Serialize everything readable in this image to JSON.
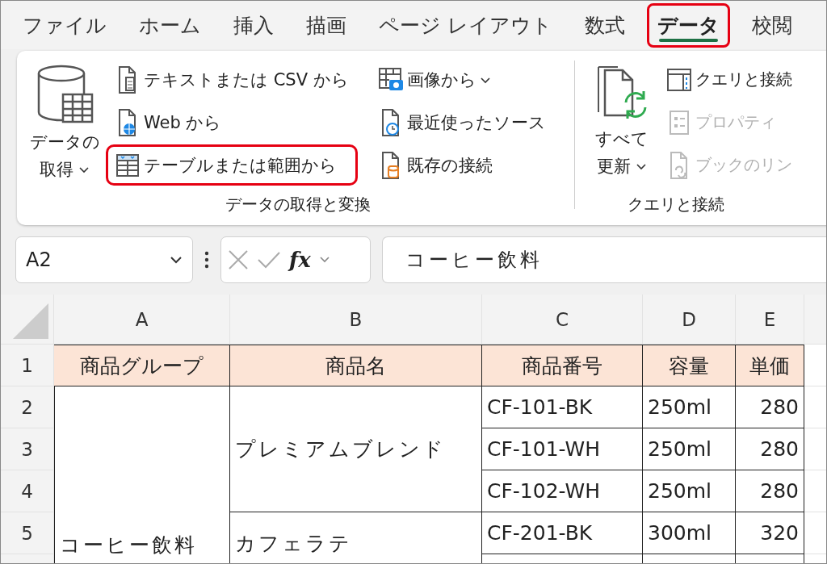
{
  "menu_tabs": [
    {
      "label": "ファイル",
      "selected": false,
      "highlighted": false
    },
    {
      "label": "ホーム",
      "selected": false,
      "highlighted": false
    },
    {
      "label": "挿入",
      "selected": false,
      "highlighted": false
    },
    {
      "label": "描画",
      "selected": false,
      "highlighted": false
    },
    {
      "label": "ページ レイアウト",
      "selected": false,
      "highlighted": false
    },
    {
      "label": "数式",
      "selected": false,
      "highlighted": false
    },
    {
      "label": "データ",
      "selected": true,
      "highlighted": true
    },
    {
      "label": "校閲",
      "selected": false,
      "highlighted": false
    }
  ],
  "ribbon": {
    "groups": [
      {
        "label": "データの取得と変換",
        "large_button": {
          "label_lines": [
            "データの",
            "取得"
          ],
          "dropdown": true
        },
        "columns": [
          [
            {
              "label": "テキストまたは CSV から",
              "disabled": false,
              "highlighted": false,
              "dropdown": false
            },
            {
              "label": "Web から",
              "disabled": false,
              "highlighted": false,
              "dropdown": false
            },
            {
              "label": "テーブルまたは範囲から",
              "disabled": false,
              "highlighted": true,
              "dropdown": false
            }
          ],
          [
            {
              "label": "画像から",
              "disabled": false,
              "highlighted": false,
              "dropdown": true
            },
            {
              "label": "最近使ったソース",
              "disabled": false,
              "highlighted": false,
              "dropdown": false
            },
            {
              "label": "既存の接続",
              "disabled": false,
              "highlighted": false,
              "dropdown": false
            }
          ]
        ]
      },
      {
        "label": "クエリと接続",
        "large_button": {
          "label_lines": [
            "すべて",
            "更新"
          ],
          "dropdown": true
        },
        "columns": [
          [
            {
              "label": "クエリと接続",
              "disabled": false,
              "highlighted": false,
              "dropdown": false
            },
            {
              "label": "プロパティ",
              "disabled": true,
              "highlighted": false,
              "dropdown": false
            },
            {
              "label": "ブックのリン",
              "disabled": true,
              "highlighted": false,
              "dropdown": false
            }
          ]
        ]
      }
    ]
  },
  "formula_bar": {
    "name_box": "A2",
    "function_label": "fx",
    "formula": "コーヒー飲料"
  },
  "sheet": {
    "column_letters": [
      "A",
      "B",
      "C",
      "D",
      "E"
    ],
    "row_numbers": [
      "1",
      "2",
      "3",
      "4",
      "5"
    ],
    "header": [
      "商品グループ",
      "商品名",
      "商品番号",
      "容量",
      "単価"
    ],
    "groups": [
      {
        "group": "コーヒー飲料",
        "products": [
          {
            "name": "プレミアムブレンド",
            "variants": [
              {
                "code": "CF-101-BK",
                "volume": "250ml",
                "price": "280"
              },
              {
                "code": "CF-101-WH",
                "volume": "250ml",
                "price": "280"
              },
              {
                "code": "CF-102-WH",
                "volume": "250ml",
                "price": "280"
              }
            ]
          },
          {
            "name": "カフェラテ",
            "variants": [
              {
                "code": "CF-201-BK",
                "volume": "300ml",
                "price": "320"
              }
            ]
          }
        ]
      }
    ]
  }
}
